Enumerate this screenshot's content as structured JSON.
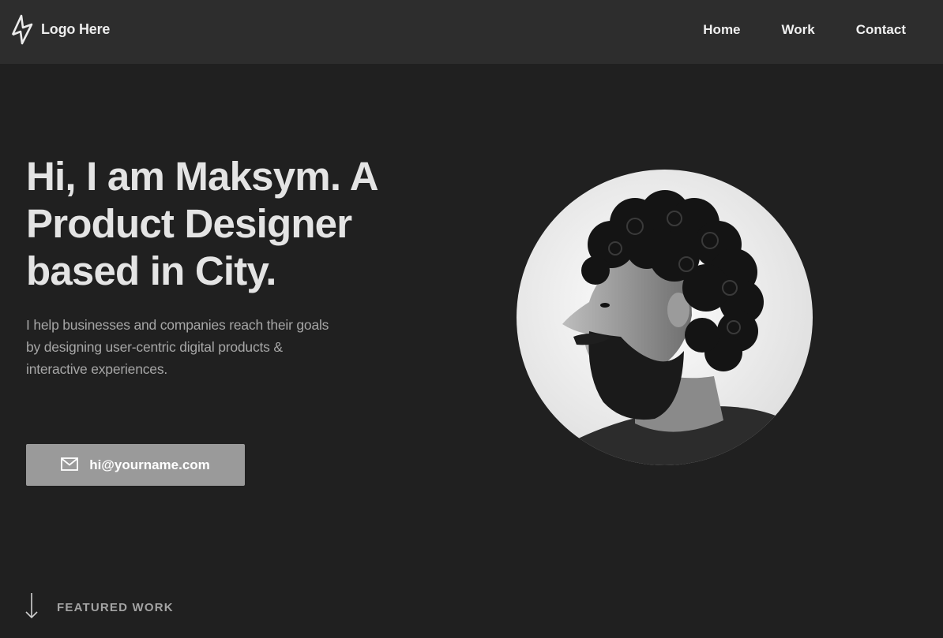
{
  "brand": {
    "logo_icon": "zigzag-logo-icon",
    "name": "Logo Here"
  },
  "nav": {
    "items": [
      {
        "label": "Home"
      },
      {
        "label": "Work"
      },
      {
        "label": "Contact"
      }
    ]
  },
  "hero": {
    "title": "Hi, I am Maksym. A Product Designer based in City.",
    "subtitle": "I help businesses and companies reach their goals by designing user-centric digital products & interactive experiences.",
    "email_button": {
      "icon": "mail-icon",
      "label": "hi@yourname.com"
    },
    "portrait": {
      "icon": "portrait-photo"
    }
  },
  "featured": {
    "icon": "arrow-down-icon",
    "label": "FEATURED WORK"
  },
  "colors": {
    "page_bg": "#202020",
    "navbar_bg": "#2d2d2d",
    "heading_text": "#e4e4e4",
    "body_text": "#a6a6a6",
    "button_bg": "#9a9a9a"
  }
}
